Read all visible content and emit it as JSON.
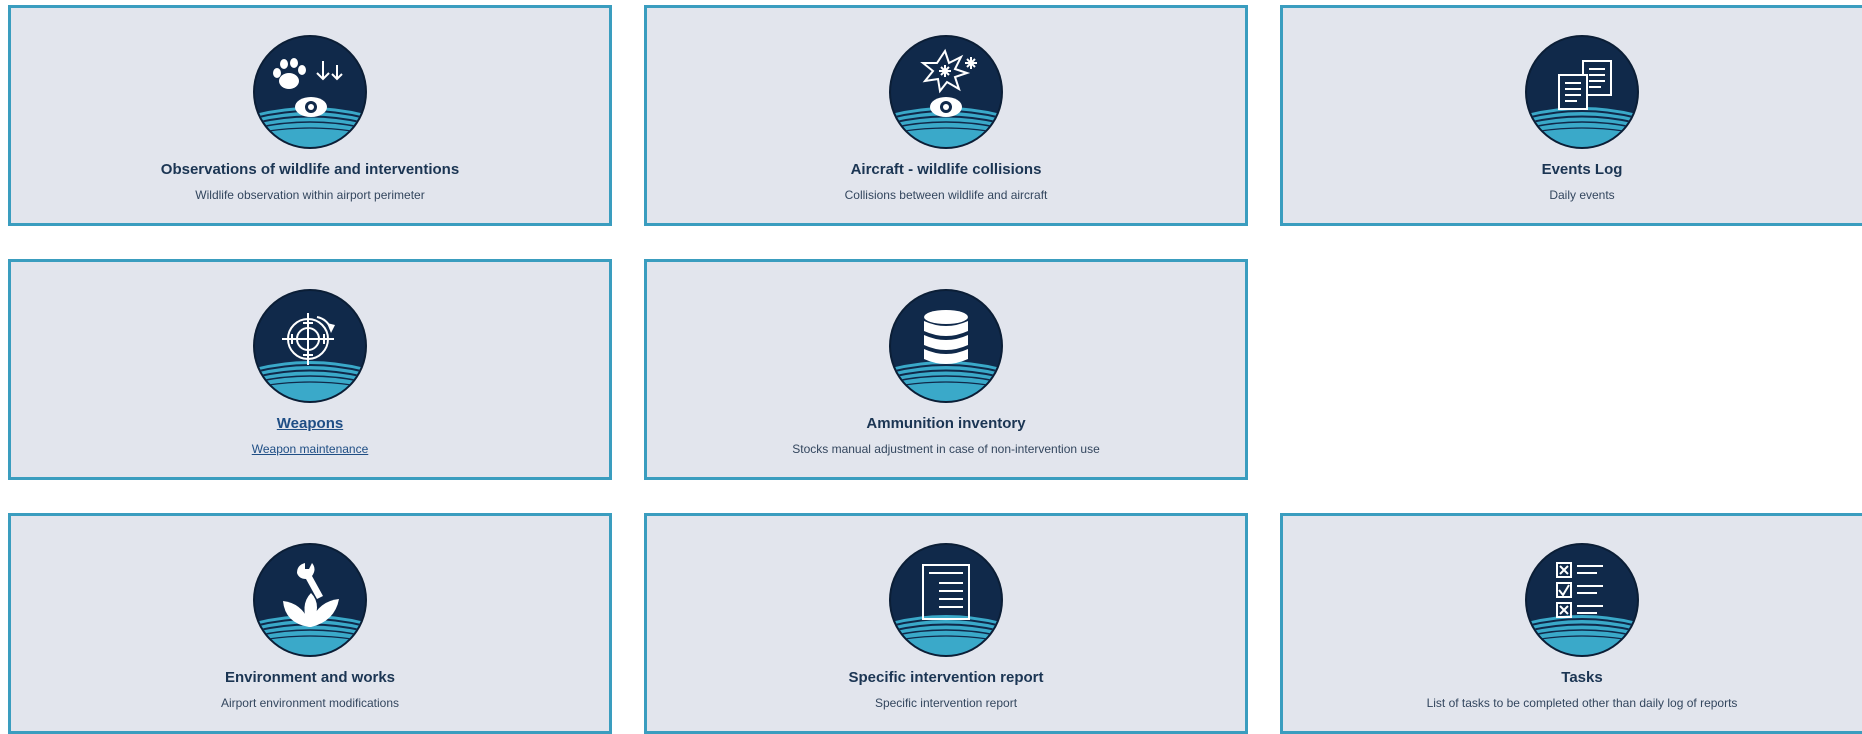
{
  "colors": {
    "tile_background": "#e2e5ed",
    "tile_border": "#3a9dbf",
    "icon_dark": "#0f2a4d",
    "icon_accent": "#3aa9c9",
    "title_text": "#1b3553"
  },
  "tiles": [
    {
      "title": "Observations of wildlife and interventions",
      "subtitle": "Wildlife observation within airport perimeter",
      "icon": "paw-eye-icon"
    },
    {
      "title": "Aircraft - wildlife collisions",
      "subtitle": "Collisions between wildlife and aircraft",
      "icon": "collision-eye-icon"
    },
    {
      "title": "Events Log",
      "subtitle": "Daily events",
      "icon": "documents-icon"
    },
    {
      "title": "Weapons",
      "subtitle": "Weapon maintenance",
      "icon": "crosshair-icon"
    },
    {
      "title": "Ammunition inventory",
      "subtitle": "Stocks manual adjustment in case of non-intervention use",
      "icon": "database-icon"
    },
    {
      "title": "Environment and works",
      "subtitle": "Airport environment modifications",
      "icon": "wrench-leaves-icon"
    },
    {
      "title": "Specific intervention report",
      "subtitle": "Specific intervention report",
      "icon": "report-icon"
    },
    {
      "title": "Tasks",
      "subtitle": "List of tasks to be completed other than daily log of reports",
      "icon": "checklist-icon"
    }
  ]
}
